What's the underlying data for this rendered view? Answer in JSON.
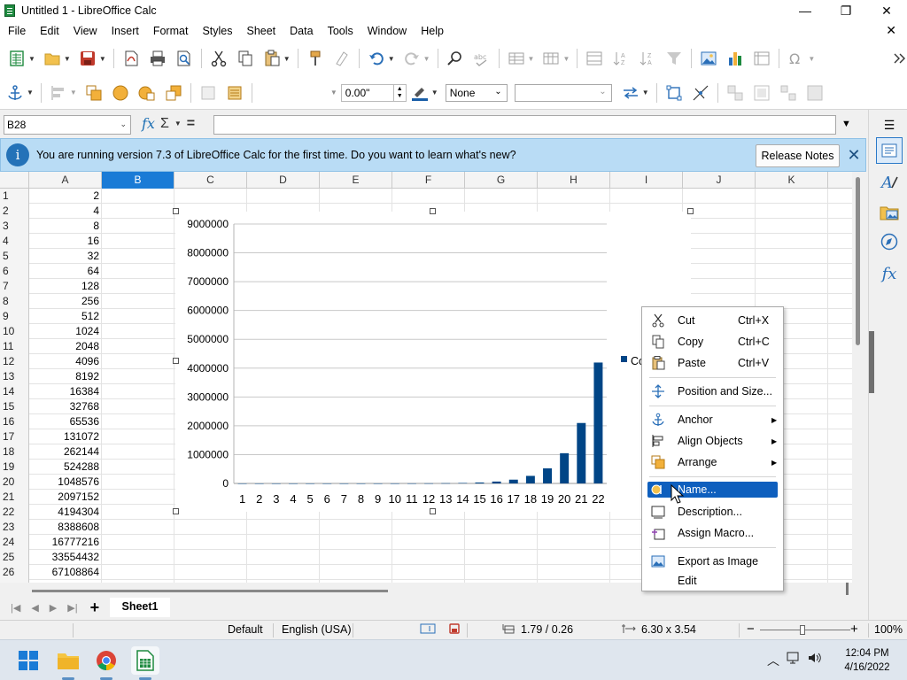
{
  "window": {
    "title": "Untitled 1 - LibreOffice Calc",
    "controls": {
      "minimize": "—",
      "maximize": "❐",
      "close": "✕"
    }
  },
  "menubar": {
    "items": [
      "File",
      "Edit",
      "View",
      "Insert",
      "Format",
      "Styles",
      "Sheet",
      "Data",
      "Tools",
      "Window",
      "Help"
    ],
    "close": "✕"
  },
  "toolbar2": {
    "line_width": "0.00\"",
    "line_style": "None",
    "area_color": ""
  },
  "formula_bar": {
    "name_box": "B28",
    "fx": "fx",
    "sigma": "Σ",
    "equals": "=",
    "content": ""
  },
  "infobar": {
    "message": "You are running version 7.3 of LibreOffice Calc for the first time. Do you want to learn what's new?",
    "button": "Release Notes",
    "close": "✕"
  },
  "grid": {
    "columns": [
      "A",
      "B",
      "C",
      "D",
      "E",
      "F",
      "G",
      "H",
      "I",
      "J",
      "K"
    ],
    "selected_column": "B",
    "rows": [
      {
        "n": "1",
        "a": "2"
      },
      {
        "n": "2",
        "a": "4"
      },
      {
        "n": "3",
        "a": "8"
      },
      {
        "n": "4",
        "a": "16"
      },
      {
        "n": "5",
        "a": "32"
      },
      {
        "n": "6",
        "a": "64"
      },
      {
        "n": "7",
        "a": "128"
      },
      {
        "n": "8",
        "a": "256"
      },
      {
        "n": "9",
        "a": "512"
      },
      {
        "n": "10",
        "a": "1024"
      },
      {
        "n": "11",
        "a": "2048"
      },
      {
        "n": "12",
        "a": "4096"
      },
      {
        "n": "13",
        "a": "8192"
      },
      {
        "n": "14",
        "a": "16384"
      },
      {
        "n": "15",
        "a": "32768"
      },
      {
        "n": "16",
        "a": "65536"
      },
      {
        "n": "17",
        "a": "131072"
      },
      {
        "n": "18",
        "a": "262144"
      },
      {
        "n": "19",
        "a": "524288"
      },
      {
        "n": "20",
        "a": "1048576"
      },
      {
        "n": "21",
        "a": "2097152"
      },
      {
        "n": "22",
        "a": "4194304"
      },
      {
        "n": "23",
        "a": "8388608"
      },
      {
        "n": "24",
        "a": "16777216"
      },
      {
        "n": "25",
        "a": "33554432"
      },
      {
        "n": "26",
        "a": "67108864"
      }
    ]
  },
  "chart_data": {
    "type": "bar",
    "categories": [
      "1",
      "2",
      "3",
      "4",
      "5",
      "6",
      "7",
      "8",
      "9",
      "10",
      "11",
      "12",
      "13",
      "14",
      "15",
      "16",
      "17",
      "18",
      "19",
      "20",
      "21",
      "22"
    ],
    "series": [
      {
        "name": "Co",
        "color": "#004586",
        "values": [
          2,
          4,
          8,
          16,
          32,
          64,
          128,
          256,
          512,
          1024,
          2048,
          4096,
          8192,
          16384,
          32768,
          65536,
          131072,
          262144,
          524288,
          1048576,
          2097152,
          4194304
        ]
      }
    ],
    "y_ticks": [
      "9000000",
      "8000000",
      "7000000",
      "6000000",
      "5000000",
      "4000000",
      "3000000",
      "2000000",
      "1000000",
      "0"
    ],
    "ylim": [
      0,
      9000000
    ],
    "grid": true,
    "legend_position": "right"
  },
  "context_menu": {
    "items": [
      {
        "label": "Cut",
        "shortcut": "Ctrl+X",
        "icon": "scissors-icon"
      },
      {
        "label": "Copy",
        "shortcut": "Ctrl+C",
        "icon": "copy-icon"
      },
      {
        "label": "Paste",
        "shortcut": "Ctrl+V",
        "icon": "paste-icon"
      },
      {
        "label": "Position and Size...",
        "icon": "position-size-icon"
      },
      {
        "label": "Anchor",
        "icon": "anchor-icon",
        "submenu": true
      },
      {
        "label": "Align Objects",
        "icon": "align-icon",
        "submenu": true
      },
      {
        "label": "Arrange",
        "icon": "arrange-icon",
        "submenu": true
      },
      {
        "label": "Name...",
        "icon": "name-icon",
        "highlighted": true
      },
      {
        "label": "Description...",
        "icon": "description-icon"
      },
      {
        "label": "Assign Macro...",
        "icon": "macro-icon"
      },
      {
        "label": "Export as Image",
        "icon": "image-icon"
      },
      {
        "label": "Edit",
        "icon": ""
      }
    ]
  },
  "sheet_tabs": {
    "active": "Sheet1",
    "add": "+"
  },
  "statusbar": {
    "page_style": "Default",
    "language": "English (USA)",
    "position": "1.79 / 0.26",
    "size": "6.30 x 3.54",
    "zoom_minus": "−",
    "zoom_plus": "+",
    "zoom": "100%"
  },
  "taskbar": {
    "time": "12:04 PM",
    "date": "4/16/2022"
  },
  "colors": {
    "accent": "#1a7bd6",
    "infobar_bg": "#b9dcf5",
    "chart_bar": "#004586",
    "menu_highlight": "#0e5fbe"
  }
}
